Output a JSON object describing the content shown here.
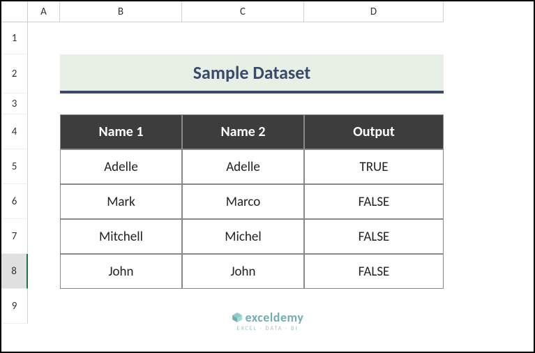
{
  "columns": {
    "A": "A",
    "B": "B",
    "C": "C",
    "D": "D"
  },
  "rows": {
    "r1": "1",
    "r2": "2",
    "r3": "3",
    "r4": "4",
    "r5": "5",
    "r6": "6",
    "r7": "7",
    "r8": "8",
    "r9": "9"
  },
  "title": "Sample Dataset",
  "headers": {
    "name1": "Name 1",
    "name2": "Name 2",
    "output": "Output"
  },
  "data_rows": [
    {
      "name1": "Adelle",
      "name2": "Adelle",
      "output": "TRUE"
    },
    {
      "name1": "Mark",
      "name2": "Marco",
      "output": "FALSE"
    },
    {
      "name1": "Mitchell",
      "name2": "Michel",
      "output": "FALSE"
    },
    {
      "name1": "John",
      "name2": "John",
      "output": "FALSE"
    }
  ],
  "watermark": {
    "brand": "exceldemy",
    "tagline": "EXCEL · DATA · BI"
  }
}
